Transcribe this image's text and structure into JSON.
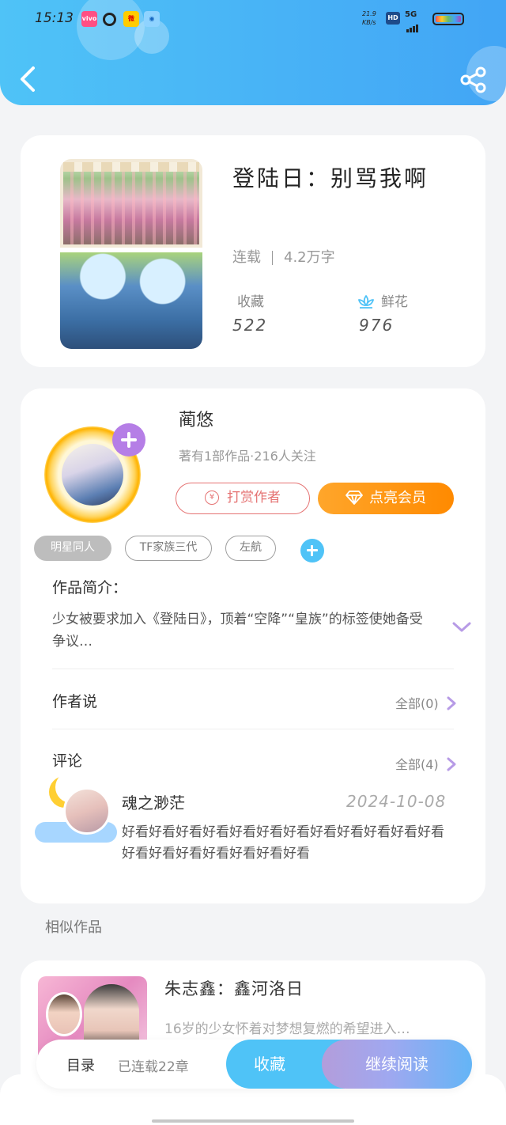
{
  "status": {
    "time": "15:13",
    "net_speed_top": "21.9",
    "net_speed_bottom": "KB/s",
    "hd": "HD",
    "network": "5G"
  },
  "book": {
    "title": "登陆日：别骂我啊",
    "status": "连载",
    "word_count": "4.2万字",
    "favorites_label": "收藏",
    "favorites_value": "522",
    "flowers_label": "鲜花",
    "flowers_value": "976"
  },
  "author": {
    "name": "蔺悠",
    "stats": "著有1部作品·216人关注",
    "tip_label": "打赏作者",
    "tip_coin": "¥",
    "vip_label": "点亮会员"
  },
  "tags": [
    "明星同人",
    "TF家族三代",
    "左航"
  ],
  "intro": {
    "heading": "作品简介：",
    "text": "少女被要求加入《登陆日》，顶着“空降”“皇族”的标签使她备受争议…"
  },
  "author_notes": {
    "heading": "作者说",
    "see_all": "全部(0)"
  },
  "comments": {
    "heading": "评论",
    "see_all": "全部(4)",
    "items": [
      {
        "user": "魂之渺茫",
        "date": "2024-10-08",
        "text": "好看好看好看好看好看好看好看好看好看好看好看好看好看好看好看好看好看好看好看"
      }
    ]
  },
  "similar": {
    "heading": "相似作品",
    "items": [
      {
        "title": "朱志鑫：鑫河洛日",
        "desc": "16岁的少女怀着对梦想复燃的希望进入…"
      }
    ]
  },
  "bottom": {
    "toc": "目录",
    "progress": "已连载22章",
    "favorite": "收藏",
    "continue": "继续阅读"
  },
  "colors": {
    "header": "#42a5f5",
    "accent_blue": "#4fc3f7",
    "accent_purple": "#b57ee6",
    "vip_orange": "#ff8a00",
    "tip_red": "#e57373"
  },
  "icons": {
    "back": "back-arrow-icon",
    "share": "share-icon",
    "flower": "lotus-flower-icon",
    "expand": "chevron-down-icon",
    "see_all": "chevron-right-icon",
    "vip": "diamond-icon",
    "add": "plus-icon"
  }
}
